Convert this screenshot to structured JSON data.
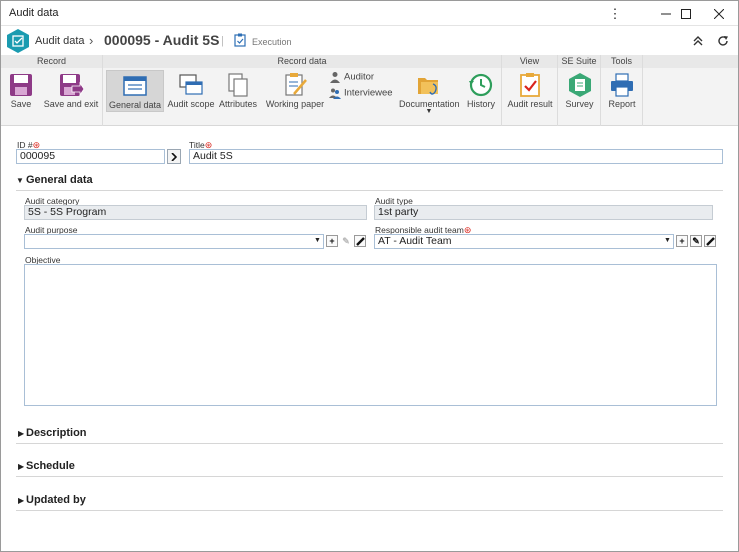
{
  "window": {
    "title": "Audit data",
    "controls": {
      "menu": "⋮",
      "minimize": "—",
      "maximize": "☐",
      "close": "✕"
    }
  },
  "header": {
    "breadcrumb_root": "Audit data",
    "breadcrumb_separator": "›",
    "record_title": "000095 - Audit 5S",
    "status_label": "Execution",
    "collapse_icon": "double-chevron-up",
    "refresh_icon": "refresh"
  },
  "ribbon": {
    "groups": [
      {
        "label": "Record",
        "buttons": [
          {
            "label": "Save",
            "icon": "save-icon"
          },
          {
            "label": "Save and exit",
            "icon": "save-exit-icon"
          }
        ]
      },
      {
        "label": "Record data",
        "buttons": [
          {
            "label": "General data",
            "icon": "general-data-icon",
            "active": true
          },
          {
            "label": "Audit scope",
            "icon": "audit-scope-icon"
          },
          {
            "label": "Attributes",
            "icon": "attributes-icon"
          },
          {
            "label": "Working paper",
            "icon": "working-paper-icon"
          },
          {
            "label": "Auditor",
            "icon": "auditor-icon"
          },
          {
            "label": "Interviewee",
            "icon": "interviewee-icon"
          },
          {
            "label": "Documentation",
            "icon": "documentation-icon"
          },
          {
            "label": "History",
            "icon": "history-icon"
          }
        ]
      },
      {
        "label": "View",
        "buttons": [
          {
            "label": "Audit result",
            "icon": "audit-result-icon"
          }
        ]
      },
      {
        "label": "SE Suite",
        "buttons": [
          {
            "label": "Survey",
            "icon": "survey-icon"
          }
        ]
      },
      {
        "label": "Tools",
        "buttons": [
          {
            "label": "Report",
            "icon": "report-icon"
          }
        ]
      }
    ]
  },
  "form": {
    "id_label": "ID #",
    "id_value": "000095",
    "title_label": "Title",
    "title_value": "Audit 5S",
    "required_mark": "⊛",
    "sections": {
      "general": "General data",
      "description": "Description",
      "schedule": "Schedule",
      "updated_by": "Updated by"
    },
    "audit_category_label": "Audit category",
    "audit_category_value": "5S - 5S Program",
    "audit_type_label": "Audit type",
    "audit_type_value": "1st party",
    "audit_purpose_label": "Audit purpose",
    "audit_purpose_value": "",
    "responsible_team_label": "Responsible audit team",
    "responsible_team_value": "AT - Audit Team",
    "objective_label": "Objective",
    "objective_value": "",
    "button_glyphs": {
      "add": "+",
      "edit": "✎",
      "clear": "⌫"
    }
  }
}
